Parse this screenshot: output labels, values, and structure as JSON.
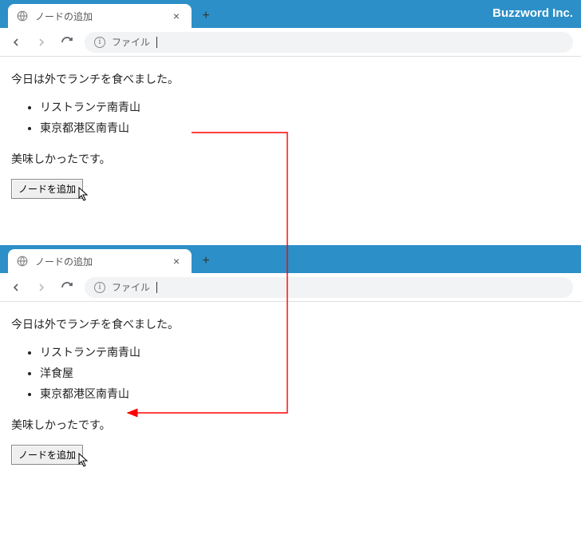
{
  "brand": "Buzzword Inc.",
  "tab_title": "ノードの追加",
  "url_label": "ファイル",
  "page": {
    "intro": "今日は外でランチを食べました。",
    "outro": "美味しかったです。",
    "button": "ノードを追加",
    "list_before": [
      "リストランテ南青山",
      "東京都港区南青山"
    ],
    "list_after": [
      "リストランテ南青山",
      "洋食屋",
      "東京都港区南青山"
    ]
  },
  "arrow_color": "#ff0000"
}
